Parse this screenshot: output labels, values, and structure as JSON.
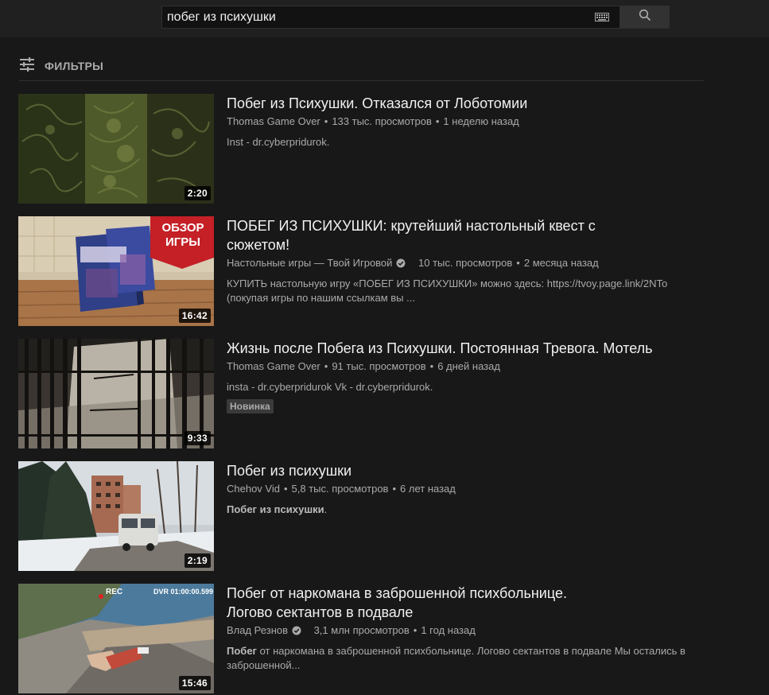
{
  "search": {
    "query": "побег из психушки",
    "keyboard_icon": "keyboard-icon",
    "search_icon": "search-icon"
  },
  "filters": {
    "label": "ФИЛЬТРЫ",
    "icon": "tune-icon"
  },
  "results": [
    {
      "title": "Побег из Психушки. Отказался от Лоботомии",
      "channel": "Thomas Game Over",
      "verified": false,
      "views": "133 тыс. просмотров",
      "age": "1 неделю назад",
      "description": "Inst - dr.cyberpridurok.",
      "duration": "2:20",
      "badge": ""
    },
    {
      "title": "ПОБЕГ ИЗ ПСИХУШКИ: крутейший настольный квест с сюжетом!",
      "channel": "Настольные игры — Твой Игровой",
      "verified": true,
      "views": "10 тыс. просмотров",
      "age": "2 месяца назад",
      "description": "КУПИТЬ настольную игру «ПОБЕГ ИЗ ПСИХУШКИ» можно здесь: https://tvoy.page.link/2NTo (покупая игры по нашим ссылкам вы ...",
      "duration": "16:42",
      "badge": "",
      "thumb_text": [
        "ОБЗОР",
        "ИГРЫ"
      ]
    },
    {
      "title": "Жизнь после Побега из Психушки. Постоянная Тревога. Мотель",
      "channel": "Thomas Game Over",
      "verified": false,
      "views": "91 тыс. просмотров",
      "age": "6 дней назад",
      "description": "insta - dr.cyberpridurok Vk - dr.cyberpridurok.",
      "duration": "9:33",
      "badge": "Новинка"
    },
    {
      "title": "Побег из психушки",
      "channel": "Chehov Vid",
      "verified": false,
      "views": "5,8 тыс. просмотров",
      "age": "6 лет назад",
      "description_bold": "Побег из психушки",
      "description_rest": ".",
      "duration": "2:19",
      "badge": ""
    },
    {
      "title": "Побег от наркомана в заброшенной психбольнице. Логово сектантов в подвале",
      "channel": "Влад Резнов",
      "verified": true,
      "views": "3,1 млн просмотров",
      "age": "1 год назад",
      "description_bold": "Побег",
      "description_rest": " от наркомана в заброшенной психбольнице. Логово сектантов в подвале Мы остались в заброшенной...",
      "duration": "15:46",
      "badge": "",
      "thumb_text": [
        "REC",
        "DVR 01:00:00.599"
      ]
    }
  ],
  "meta_separator": "•"
}
